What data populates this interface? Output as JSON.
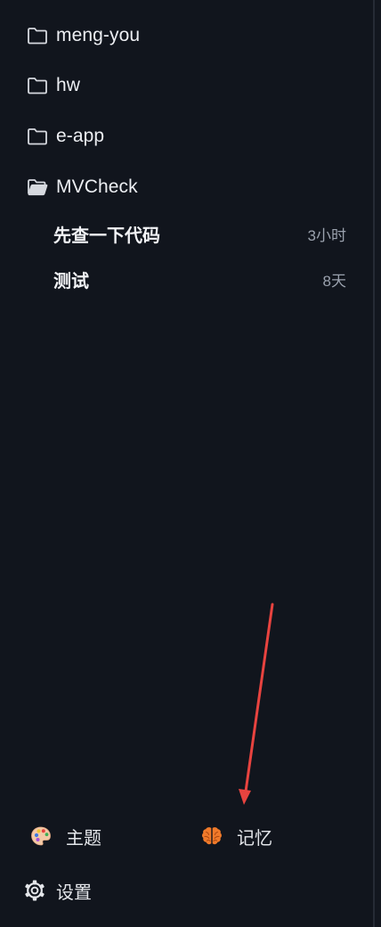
{
  "folders": [
    {
      "name": "meng-you",
      "icon": "folder-icon"
    },
    {
      "name": "hw",
      "icon": "folder-icon"
    },
    {
      "name": "e-app",
      "icon": "folder-icon"
    },
    {
      "name": "MVCheck",
      "icon": "folder-open-icon"
    }
  ],
  "sessions": [
    {
      "title": "先查一下代码",
      "time": "3小时"
    },
    {
      "title": "测试",
      "time": "8天"
    }
  ],
  "bottom": {
    "theme_label": "主题",
    "theme_icon": "palette-icon",
    "memory_label": "记忆",
    "memory_icon": "brain-icon",
    "settings_label": "设置",
    "settings_icon": "gear-icon"
  },
  "colors": {
    "background": "#11151d",
    "annotation_arrow": "#e8433f",
    "brain": "#f07a2a"
  }
}
